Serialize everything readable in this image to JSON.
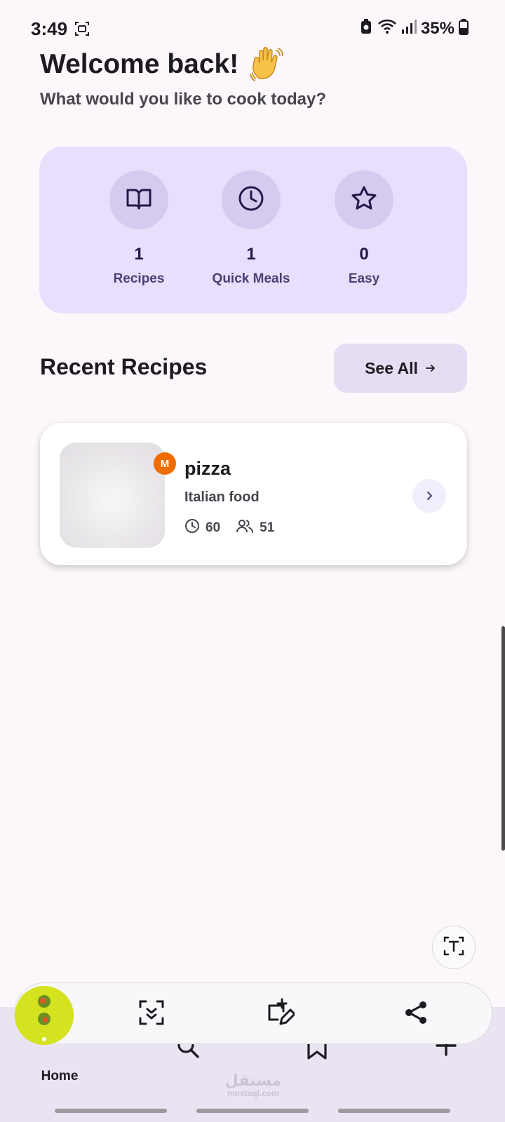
{
  "status_bar": {
    "time": "3:49",
    "battery": "35%"
  },
  "header": {
    "title": "Welcome back!",
    "subtitle": "What would you like to cook today?"
  },
  "stats": [
    {
      "icon": "book-icon",
      "value": "1",
      "label": "Recipes"
    },
    {
      "icon": "clock-icon",
      "value": "1",
      "label": "Quick Meals"
    },
    {
      "icon": "star-icon",
      "value": "0",
      "label": "Easy"
    }
  ],
  "recent": {
    "title": "Recent Recipes",
    "see_all_label": "See All"
  },
  "recipes": [
    {
      "name": "pizza",
      "category": "Italian food",
      "badge": "M",
      "time": "60",
      "servings": "51"
    }
  ],
  "bottom_nav": {
    "home_label": "Home"
  },
  "watermark": {
    "arabic": "مستقل",
    "latin": "mostaql.com"
  },
  "colors": {
    "accent": "#e7dffb",
    "badge": "#ef6c00",
    "icon_primary": "#22194a"
  }
}
